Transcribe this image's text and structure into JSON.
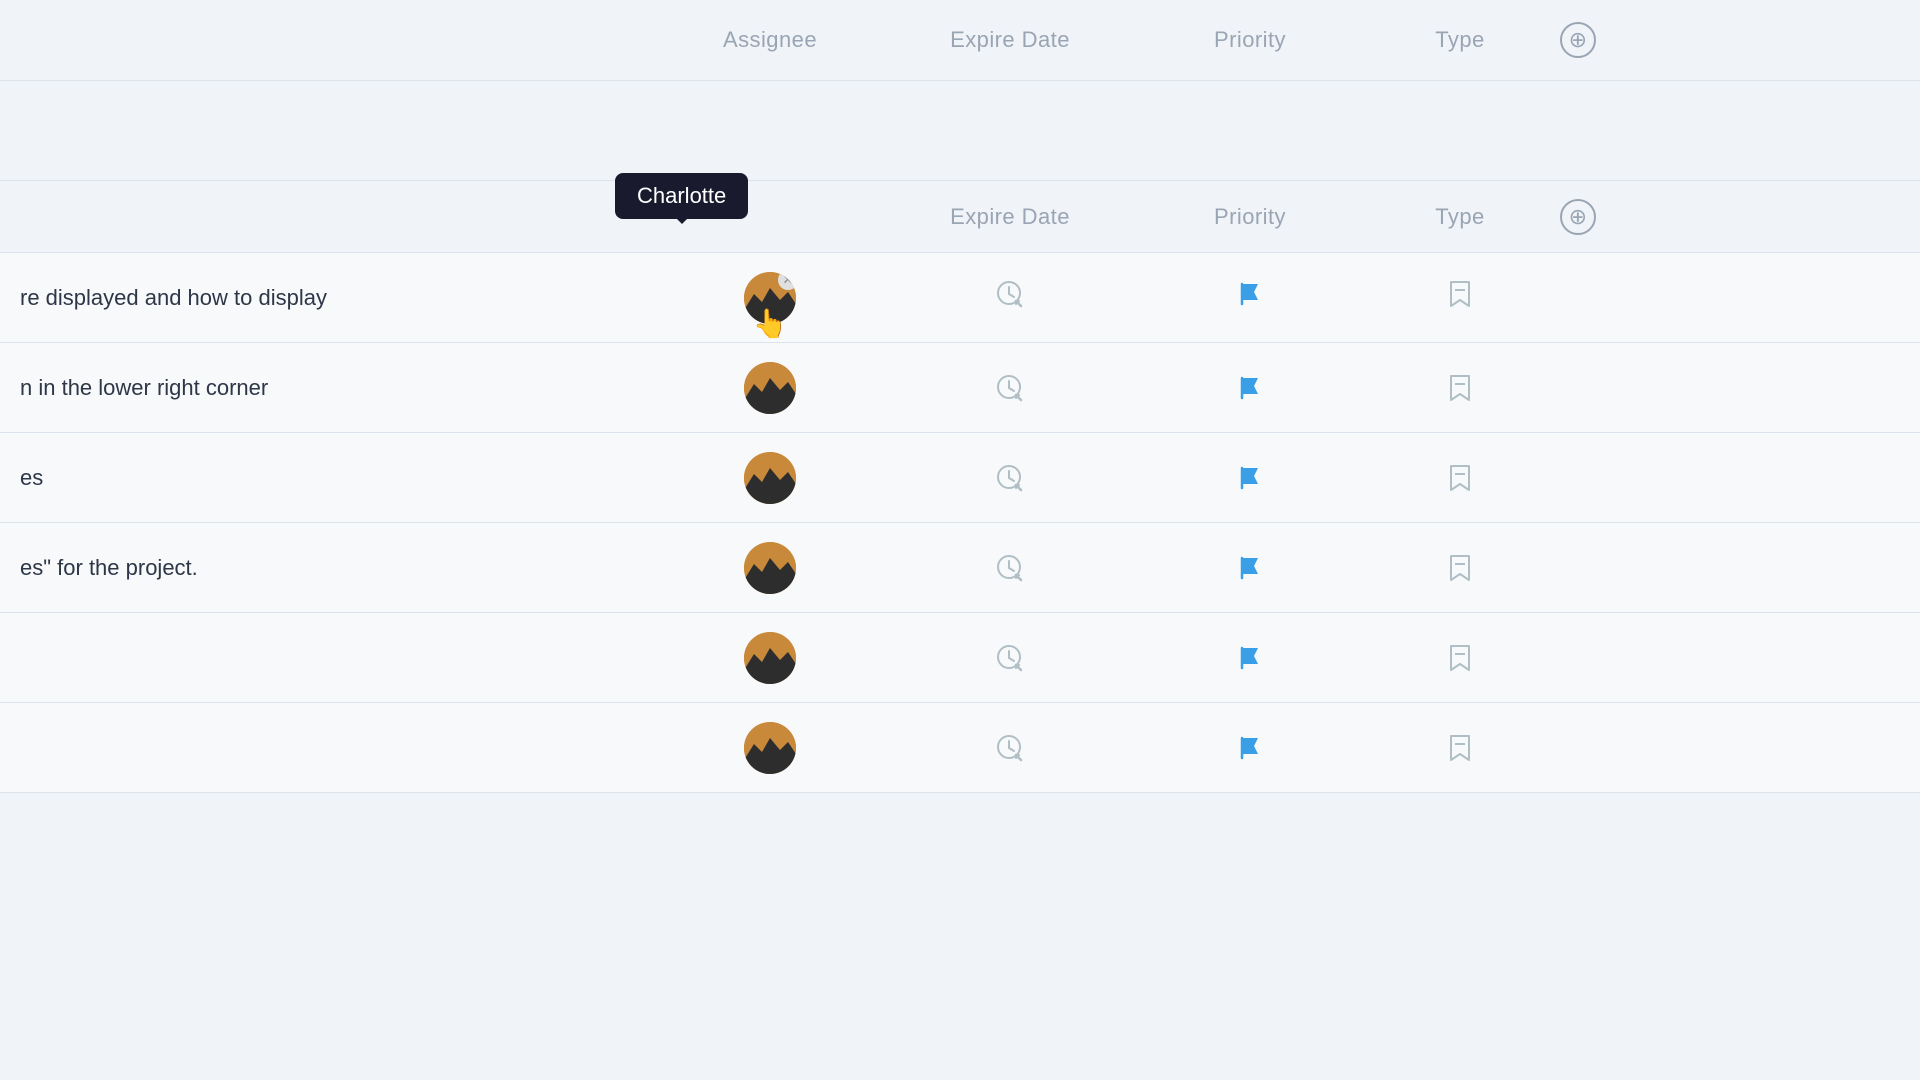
{
  "header": {
    "columns": {
      "assignee": "Assignee",
      "expire_date": "Expire Date",
      "priority": "Priority",
      "type": "Type",
      "add": "+"
    }
  },
  "subheader": {
    "columns": {
      "assignee_tooltip": "Charlotte",
      "expire_date": "Expire Date",
      "priority": "Priority",
      "type": "Type",
      "add": "+"
    }
  },
  "rows": [
    {
      "text": "re displayed and how to display",
      "has_tooltip": true,
      "has_remove": true
    },
    {
      "text": "n in the lower right corner",
      "has_tooltip": false,
      "has_remove": false
    },
    {
      "text": "es",
      "has_tooltip": false,
      "has_remove": false
    },
    {
      "text": "es\" for the project.",
      "has_tooltip": false,
      "has_remove": false
    },
    {
      "text": "",
      "has_tooltip": false,
      "has_remove": false
    },
    {
      "text": "",
      "has_tooltip": false,
      "has_remove": false
    }
  ]
}
